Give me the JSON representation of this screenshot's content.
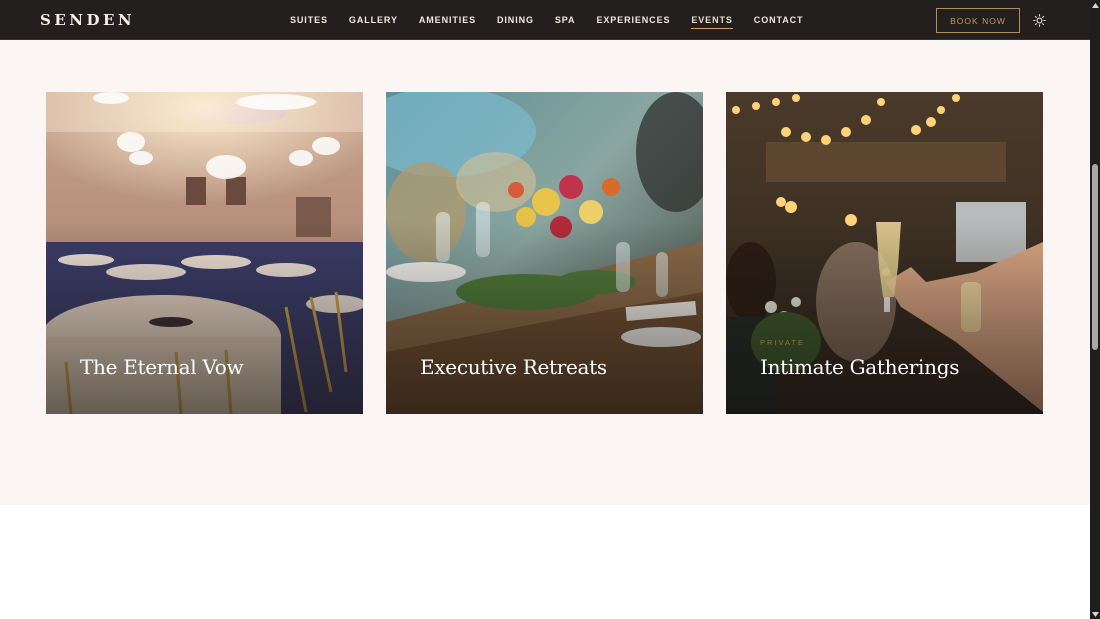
{
  "brand": {
    "logo": "SENDEN"
  },
  "nav": {
    "items": [
      {
        "label": "SUITES"
      },
      {
        "label": "GALLERY"
      },
      {
        "label": "AMENITIES"
      },
      {
        "label": "DINING"
      },
      {
        "label": "SPA"
      },
      {
        "label": "EXPERIENCES"
      },
      {
        "label": "EVENTS",
        "active": true
      },
      {
        "label": "CONTACT"
      }
    ],
    "cta_label": "BOOK NOW",
    "theme_icon": "sun-icon"
  },
  "events": {
    "cards": [
      {
        "eyebrow": "",
        "title": "The Eternal Vow"
      },
      {
        "eyebrow": "",
        "title": "Executive Retreats"
      },
      {
        "eyebrow": "PRIVATE",
        "title": "Intimate Gatherings"
      }
    ]
  },
  "colors": {
    "header_bg": "#241f1f",
    "accent_gold": "#c39a5a",
    "section_bg": "#fbf6f3"
  }
}
